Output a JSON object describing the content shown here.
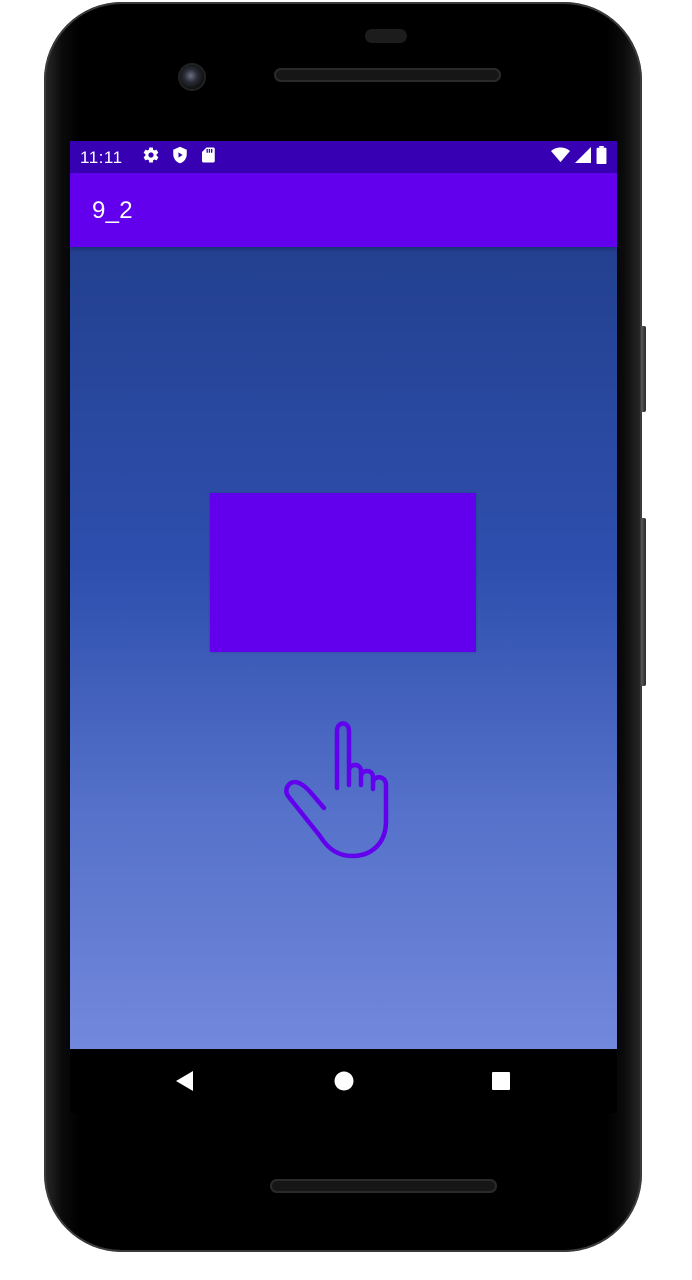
{
  "status_bar": {
    "time": "11:11",
    "left_icons": [
      "settings-icon",
      "shield-icon",
      "sd-card-icon"
    ],
    "right_icons": [
      "wifi-icon",
      "cell-signal-icon",
      "battery-icon"
    ],
    "background_color": "#3700b3"
  },
  "app_bar": {
    "title": "9_2",
    "background_color": "#6200ee"
  },
  "content": {
    "gradient_top": "#23408f",
    "gradient_bottom": "#7288dc",
    "box_color": "#6200ee",
    "gesture_icon": "touch-hand-icon",
    "gesture_icon_color": "#6200ee"
  },
  "navigation_bar": {
    "buttons": [
      "back-icon",
      "home-icon",
      "recents-icon"
    ]
  }
}
